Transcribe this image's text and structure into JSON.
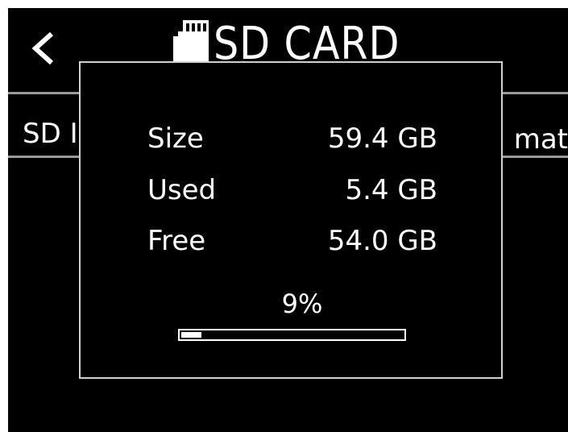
{
  "header": {
    "title": "SD CARD",
    "back_icon": "chevron-left-icon",
    "card_icon": "sd-card-icon"
  },
  "menu_row": {
    "left_label": "SD I",
    "right_label": "mat"
  },
  "dialog": {
    "stats": [
      {
        "label": "Size",
        "value": "59.4 GB"
      },
      {
        "label": "Used",
        "value": "5.4 GB"
      },
      {
        "label": "Free",
        "value": "54.0 GB"
      }
    ],
    "usage_text": "9%",
    "usage_fraction": 0.09
  },
  "colors": {
    "background": "#000000",
    "foreground": "#ffffff",
    "divider": "#9a9a9a",
    "dialog_border": "#cfcfcf"
  }
}
